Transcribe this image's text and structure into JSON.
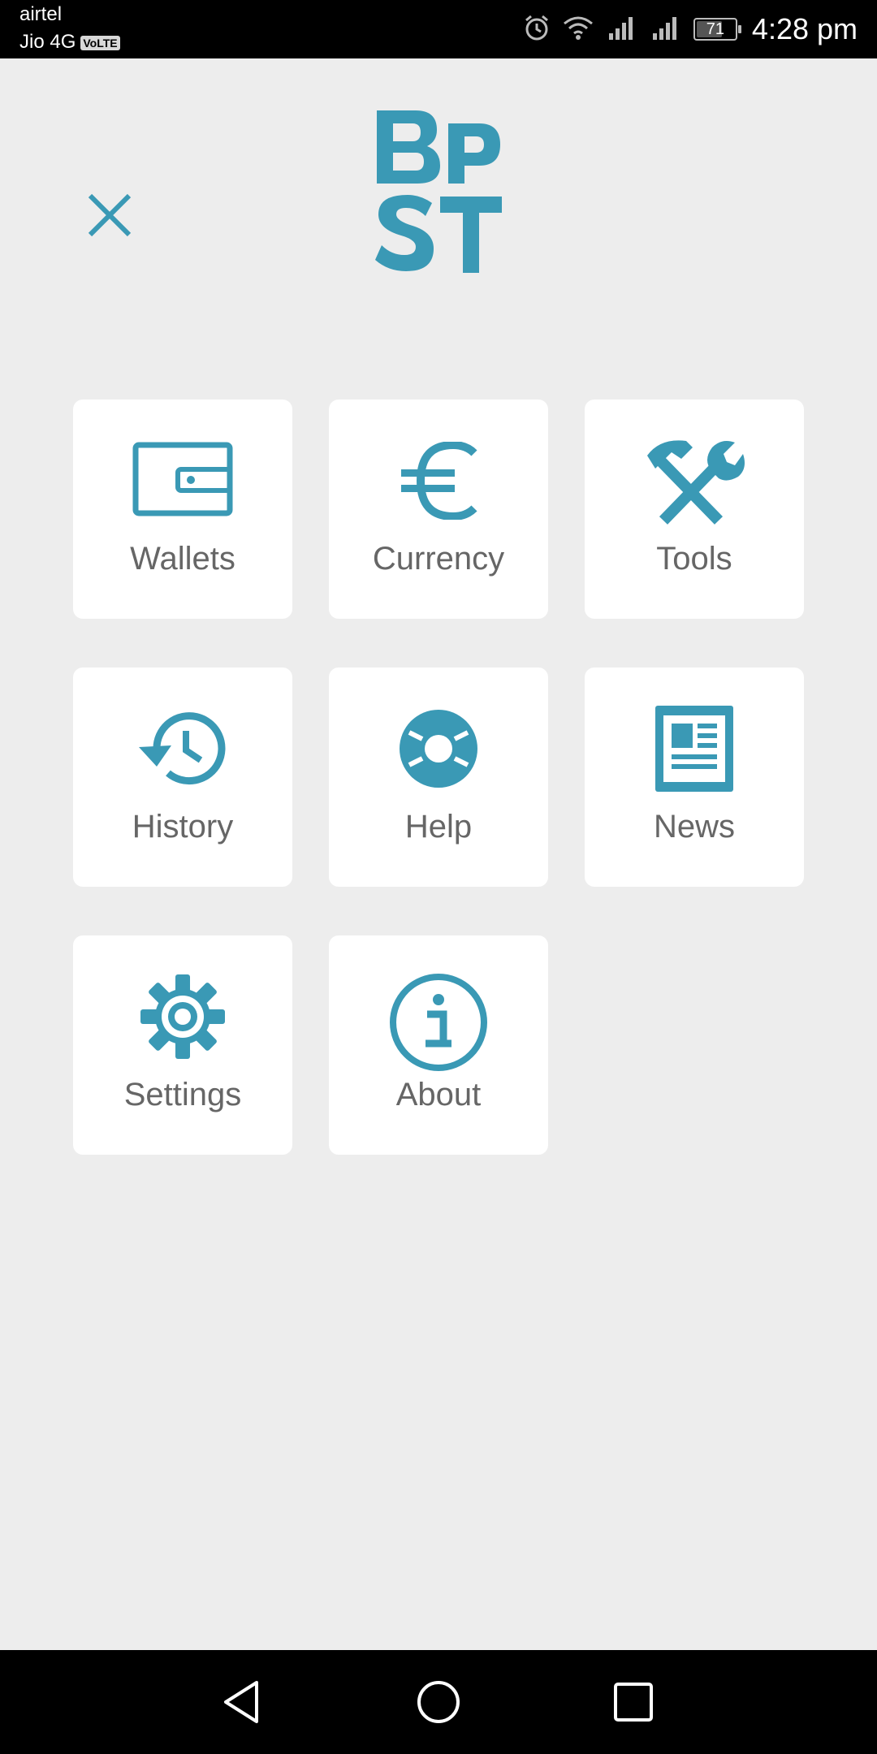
{
  "status_bar": {
    "carrier_1": "airtel",
    "carrier_2": "Jio 4G",
    "volte_badge": "VoLTE",
    "battery_percent": 71,
    "battery_label": "71",
    "time": "4:28 pm",
    "icons": [
      "alarm-icon",
      "wifi-icon",
      "signal-icon",
      "signal-icon",
      "battery-icon"
    ]
  },
  "header": {
    "close_icon": "close-icon",
    "logo_text": "BP ST"
  },
  "menu": {
    "items": [
      {
        "label": "Wallets",
        "icon": "wallet-icon"
      },
      {
        "label": "Currency",
        "icon": "euro-icon"
      },
      {
        "label": "Tools",
        "icon": "tools-icon"
      },
      {
        "label": "History",
        "icon": "history-icon"
      },
      {
        "label": "Help",
        "icon": "lifebuoy-icon"
      },
      {
        "label": "News",
        "icon": "newspaper-icon"
      },
      {
        "label": "Settings",
        "icon": "gear-icon"
      },
      {
        "label": "About",
        "icon": "info-icon"
      }
    ]
  },
  "nav_bar": {
    "icons": [
      "back-icon",
      "home-icon",
      "recents-icon"
    ]
  },
  "colors": {
    "accent": "#3a99b5",
    "background": "#ededed",
    "tile": "#ffffff",
    "label": "#666666"
  }
}
